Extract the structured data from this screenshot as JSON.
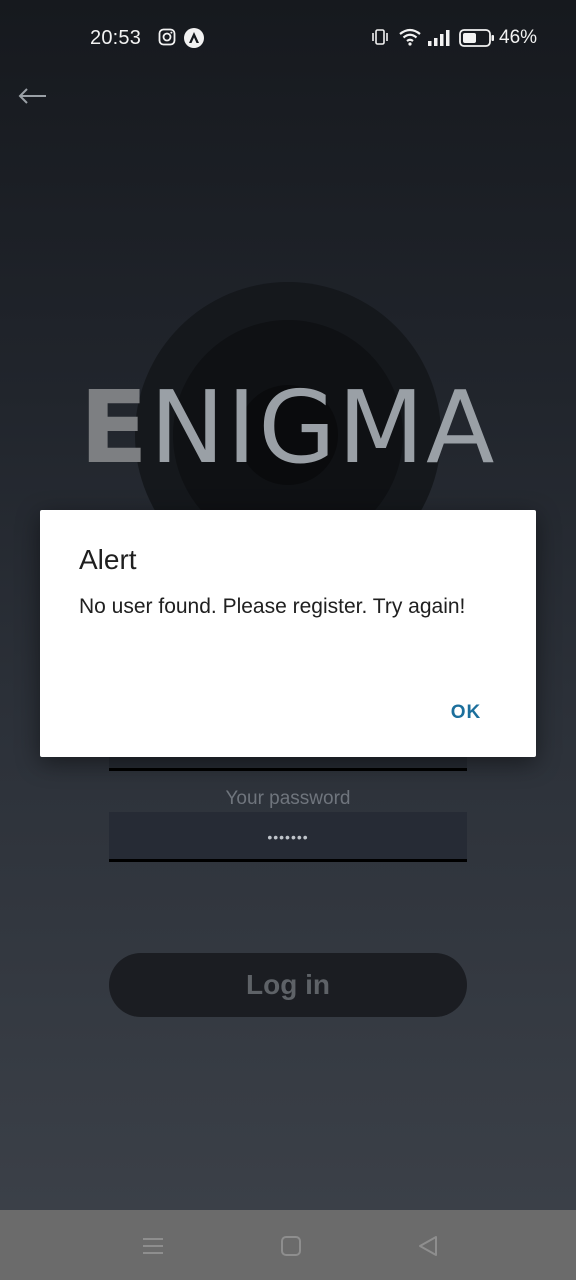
{
  "status_bar": {
    "time": "20:53",
    "battery_percent": "46%",
    "icons": [
      "instagram-icon",
      "app-notification-icon",
      "vibrate-icon",
      "wifi-icon",
      "signal-icon",
      "battery-icon"
    ]
  },
  "header": {
    "back_icon": "back-arrow-icon"
  },
  "logo": {
    "first_letter": "E",
    "rest": "NIGMA"
  },
  "form": {
    "password_label": "Your password",
    "password_value": "•••••••",
    "login_label": "Log in"
  },
  "dialog": {
    "title": "Alert",
    "message": "No user found. Please register. Try again!",
    "ok_label": "OK"
  },
  "nav": {
    "icons": [
      "menu-icon",
      "home-icon",
      "back-icon"
    ]
  },
  "colors": {
    "accent": "#1c6f9c",
    "background_top": "#16191e",
    "background_bottom": "#3b4048",
    "nav_bar": "#6b6b6b"
  }
}
